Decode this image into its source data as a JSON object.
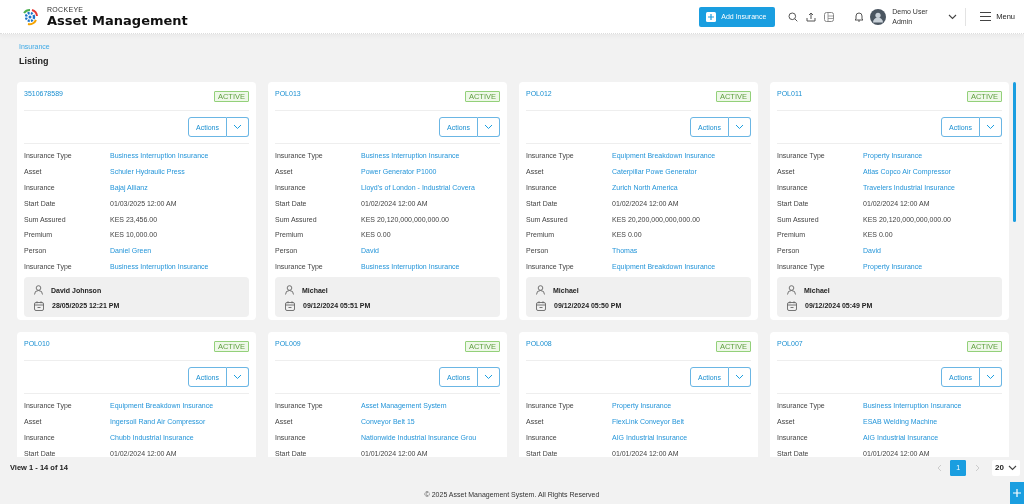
{
  "header": {
    "brand": "ROCKEYE",
    "app_name": "Asset Management",
    "add_button": "Add Insurance",
    "user": {
      "name": "Demo User",
      "role": "Admin"
    },
    "menu_label": "Menu"
  },
  "breadcrumb": "Insurance",
  "page_title": "Listing",
  "cards": [
    {
      "policy": "3510678589",
      "status": "ACTIVE",
      "actions_label": "Actions",
      "fields": [
        {
          "label": "Insurance Type",
          "value": "Business Interruption Insurance",
          "kind": "link"
        },
        {
          "label": "Asset",
          "value": "Schuler Hydraulic Press",
          "kind": "link"
        },
        {
          "label": "Insurance",
          "value": "Bajaj Allianz",
          "kind": "link"
        },
        {
          "label": "Start Date",
          "value": "01/03/2025 12:00 AM",
          "kind": "text"
        },
        {
          "label": "Sum Assured",
          "value": "KES 23,456.00",
          "kind": "text"
        },
        {
          "label": "Premium",
          "value": "KES 10,000.00",
          "kind": "text"
        },
        {
          "label": "Person",
          "value": "Daniel Green",
          "kind": "link"
        },
        {
          "label": "Insurance Type",
          "value": "Business Interruption Insurance",
          "kind": "link"
        }
      ],
      "created_by": "David Johnson",
      "created_at": "28/05/2025 12:21 PM"
    },
    {
      "policy": "POL013",
      "status": "ACTIVE",
      "actions_label": "Actions",
      "fields": [
        {
          "label": "Insurance Type",
          "value": "Business Interruption Insurance",
          "kind": "link"
        },
        {
          "label": "Asset",
          "value": "Power Generator P1000",
          "kind": "link"
        },
        {
          "label": "Insurance",
          "value": "Lloyd's of London - Industrial Covera",
          "kind": "link"
        },
        {
          "label": "Start Date",
          "value": "01/02/2024 12:00 AM",
          "kind": "text"
        },
        {
          "label": "Sum Assured",
          "value": "KES 20,120,000,000,000.00",
          "kind": "text"
        },
        {
          "label": "Premium",
          "value": "KES 0.00",
          "kind": "text"
        },
        {
          "label": "Person",
          "value": "David",
          "kind": "link"
        },
        {
          "label": "Insurance Type",
          "value": "Business Interruption Insurance",
          "kind": "link"
        }
      ],
      "created_by": "Michael",
      "created_at": "09/12/2024 05:51 PM"
    },
    {
      "policy": "POL012",
      "status": "ACTIVE",
      "actions_label": "Actions",
      "fields": [
        {
          "label": "Insurance Type",
          "value": "Equipment Breakdown Insurance",
          "kind": "link"
        },
        {
          "label": "Asset",
          "value": "Caterpillar Powe Generator",
          "kind": "link"
        },
        {
          "label": "Insurance",
          "value": "Zurich North America",
          "kind": "link"
        },
        {
          "label": "Start Date",
          "value": "01/02/2024 12:00 AM",
          "kind": "text"
        },
        {
          "label": "Sum Assured",
          "value": "KES 20,200,000,000,000.00",
          "kind": "text"
        },
        {
          "label": "Premium",
          "value": "KES 0.00",
          "kind": "text"
        },
        {
          "label": "Person",
          "value": "Thomas",
          "kind": "link"
        },
        {
          "label": "Insurance Type",
          "value": "Equipment Breakdown Insurance",
          "kind": "link"
        }
      ],
      "created_by": "Michael",
      "created_at": "09/12/2024 05:50 PM"
    },
    {
      "policy": "POL011",
      "status": "ACTIVE",
      "actions_label": "Actions",
      "fields": [
        {
          "label": "Insurance Type",
          "value": "Property Insurance",
          "kind": "link"
        },
        {
          "label": "Asset",
          "value": "Atlas Copco Air Compressor",
          "kind": "link"
        },
        {
          "label": "Insurance",
          "value": "Travelers Industrial Insurance",
          "kind": "link"
        },
        {
          "label": "Start Date",
          "value": "01/02/2024 12:00 AM",
          "kind": "text"
        },
        {
          "label": "Sum Assured",
          "value": "KES 20,120,000,000,000.00",
          "kind": "text"
        },
        {
          "label": "Premium",
          "value": "KES 0.00",
          "kind": "text"
        },
        {
          "label": "Person",
          "value": "David",
          "kind": "link"
        },
        {
          "label": "Insurance Type",
          "value": "Property Insurance",
          "kind": "link"
        }
      ],
      "created_by": "Michael",
      "created_at": "09/12/2024 05:49 PM"
    },
    {
      "policy": "POL010",
      "status": "ACTIVE",
      "actions_label": "Actions",
      "fields": [
        {
          "label": "Insurance Type",
          "value": "Equipment Breakdown Insurance",
          "kind": "link"
        },
        {
          "label": "Asset",
          "value": "Ingersoll Rand Air Compressor",
          "kind": "link"
        },
        {
          "label": "Insurance",
          "value": "Chubb Industrial Insurance",
          "kind": "link"
        },
        {
          "label": "Start Date",
          "value": "01/02/2024 12:00 AM",
          "kind": "text"
        }
      ]
    },
    {
      "policy": "POL009",
      "status": "ACTIVE",
      "actions_label": "Actions",
      "fields": [
        {
          "label": "Insurance Type",
          "value": "Asset Management System",
          "kind": "link"
        },
        {
          "label": "Asset",
          "value": "Conveyor Belt 15",
          "kind": "link"
        },
        {
          "label": "Insurance",
          "value": "Nationwide Industrial Insurance Grou",
          "kind": "link"
        },
        {
          "label": "Start Date",
          "value": "01/01/2024 12:00 AM",
          "kind": "text"
        }
      ]
    },
    {
      "policy": "POL008",
      "status": "ACTIVE",
      "actions_label": "Actions",
      "fields": [
        {
          "label": "Insurance Type",
          "value": "Property Insurance",
          "kind": "link"
        },
        {
          "label": "Asset",
          "value": "FlexLink Conveyor Belt",
          "kind": "link"
        },
        {
          "label": "Insurance",
          "value": "AIG Industrial Insurance",
          "kind": "link"
        },
        {
          "label": "Start Date",
          "value": "01/01/2024 12:00 AM",
          "kind": "text"
        }
      ]
    },
    {
      "policy": "POL007",
      "status": "ACTIVE",
      "actions_label": "Actions",
      "fields": [
        {
          "label": "Insurance Type",
          "value": "Business Interruption Insurance",
          "kind": "link"
        },
        {
          "label": "Asset",
          "value": "ESAB Welding Machine",
          "kind": "link"
        },
        {
          "label": "Insurance",
          "value": "AIG Industrial Insurance",
          "kind": "link"
        },
        {
          "label": "Start Date",
          "value": "01/01/2024 12:00 AM",
          "kind": "text"
        }
      ]
    }
  ],
  "pager": {
    "summary": "View 1 - 14 of 14",
    "prev": {
      "disabled": true
    },
    "pages": [
      {
        "label": "1",
        "selected": true
      }
    ],
    "next": {
      "disabled": true
    },
    "page_size": "20"
  },
  "footer": "© 2025 Asset Management System. All Rights Reserved"
}
